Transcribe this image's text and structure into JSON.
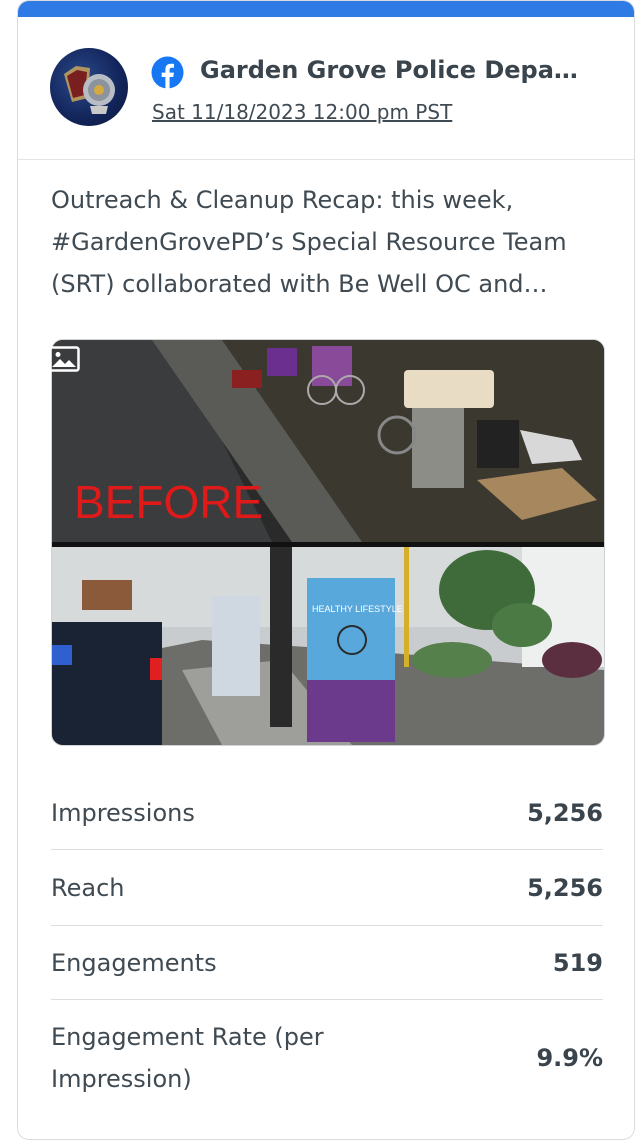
{
  "post": {
    "page_name": "Garden Grove Police Depa…",
    "date": "Sat 11/18/2023 12:00 pm PST",
    "text": "Outreach & Cleanup Recap: this week, #GardenGrovePD’s Special Resource Team (SRT) collaborated with Be Well OC and…",
    "network_icon": "facebook-icon",
    "media": {
      "type": "image",
      "overlay_text": "BEFORE",
      "box_text": "HEALTHY LIFESTYLE",
      "badge_icon": "image-icon"
    }
  },
  "stats": [
    {
      "label": "Impressions",
      "value": "5,256"
    },
    {
      "label": "Reach",
      "value": "5,256"
    },
    {
      "label": "Engagements",
      "value": "519"
    },
    {
      "label": "Engagement Rate (per Impression)",
      "value": "9.9%"
    }
  ],
  "colors": {
    "accent": "#2e7be6",
    "facebook": "#1877f2",
    "text": "#3f4a52",
    "divider": "#dcdfe2"
  }
}
